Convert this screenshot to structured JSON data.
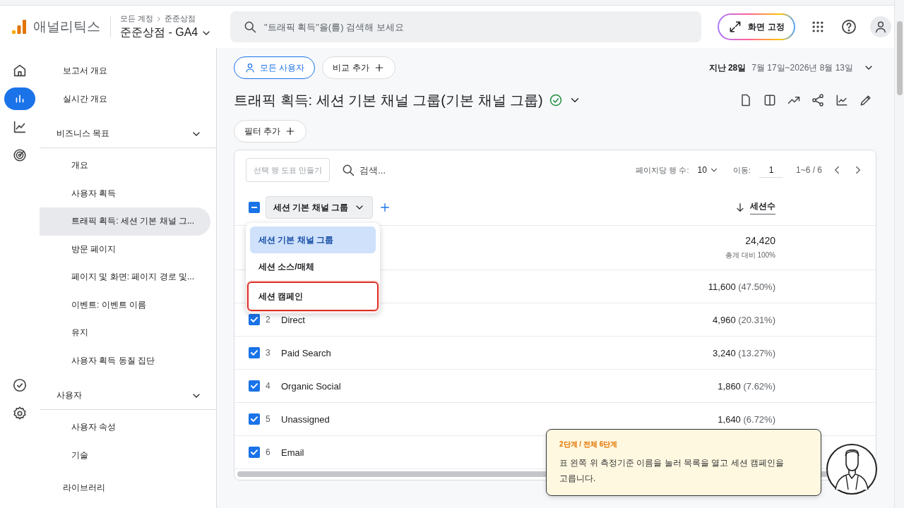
{
  "header": {
    "logo_text": "애널리틱스",
    "breadcrumb": [
      "모든 계정",
      "준준상점"
    ],
    "property": "준준상점 - GA4",
    "search_placeholder": "\"트래픽 획득\"을(를) 검색해 보세요",
    "pin_button": "화면 고정"
  },
  "rail": {
    "top": [
      {
        "kind": "home",
        "selected": false
      },
      {
        "kind": "reports",
        "selected": true
      },
      {
        "kind": "explore",
        "selected": false
      },
      {
        "kind": "advertising",
        "selected": false
      }
    ],
    "bottom": [
      {
        "kind": "check",
        "selected": false
      },
      {
        "kind": "settings",
        "selected": false
      }
    ]
  },
  "nav": [
    {
      "kind": "link",
      "label": "보고서 개요",
      "selected": false
    },
    {
      "kind": "link",
      "label": "실시간 개요",
      "selected": false
    },
    {
      "kind": "section",
      "label": "비즈니스 목표",
      "expanded": true,
      "children": [
        {
          "label": "개요",
          "selected": false
        },
        {
          "label": "사용자 획득",
          "selected": false
        },
        {
          "label": "트래픽 획득: 세션 기본 채널 그...",
          "selected": true
        },
        {
          "label": "방문 페이지",
          "selected": false
        },
        {
          "label": "페이지 및 화면: 페이지 경로 및...",
          "selected": false
        },
        {
          "label": "이벤트: 이벤트 이름",
          "selected": false
        },
        {
          "label": "유지",
          "selected": false
        },
        {
          "label": "사용자 획득 동질 집단",
          "selected": false
        }
      ]
    },
    {
      "kind": "section",
      "label": "사용자",
      "expanded": true,
      "children": [
        {
          "label": "사용자 속성",
          "selected": false
        },
        {
          "label": "기술",
          "selected": false
        }
      ]
    },
    {
      "kind": "link",
      "label": "라이브러리",
      "selected": false
    }
  ],
  "chips": [
    {
      "kind": "segment",
      "label": "모든 사용자"
    },
    {
      "kind": "add",
      "label": "비교 추가"
    }
  ],
  "date": {
    "prefix": "지난 28일",
    "range": "7월 17일~2026년 8월 13일"
  },
  "title": "트래픽 획득: 세션 기본 채널 그룹(기본 채널 그룹)",
  "filter_button": "필터 추가",
  "table": {
    "plot_button": {
      "label": "선택 행 도표 만들기",
      "disabled": true
    },
    "search_placeholder": "검색...",
    "rows_per_page_label": "페이지당 행 수:",
    "rows_per_page": "10",
    "goto_label": "이동:",
    "goto_value": "1",
    "range": "1~6 / 6",
    "select_all_partial": true,
    "dimension": "세션 기본 채널 그룹",
    "metric": "세션수",
    "total": {
      "value": "24,420",
      "share": "총계 대비 100%"
    },
    "rows": [
      {
        "value": "11,600",
        "percent": "(47.50%)"
      },
      {
        "checked": true,
        "index": "2",
        "label": "Direct",
        "value": "4,960",
        "percent": "(20.31%)"
      },
      {
        "checked": true,
        "index": "3",
        "label": "Paid Search",
        "value": "3,240",
        "percent": "(13.27%)"
      },
      {
        "checked": true,
        "index": "4",
        "label": "Organic Social",
        "value": "1,860",
        "percent": "(7.62%)"
      },
      {
        "checked": true,
        "index": "5",
        "label": "Unassigned",
        "value": "1,640",
        "percent": "(6.72%)"
      },
      {
        "checked": true,
        "index": "6",
        "label": "Email"
      }
    ]
  },
  "dropdown": [
    {
      "label": "세션 기본 채널 그룹",
      "selected": true,
      "highlighted": false
    },
    {
      "label": "세션 소스/매체",
      "selected": false,
      "highlighted": false
    },
    {
      "label": "세션 캠페인",
      "selected": false,
      "highlighted": true
    }
  ],
  "tour": {
    "step": "2단계 / 전체 6단계",
    "text": "표 왼쪽 위 측정기준 이름을 눌러 목록을 열고 세션 캠페인을 고릅니다."
  }
}
